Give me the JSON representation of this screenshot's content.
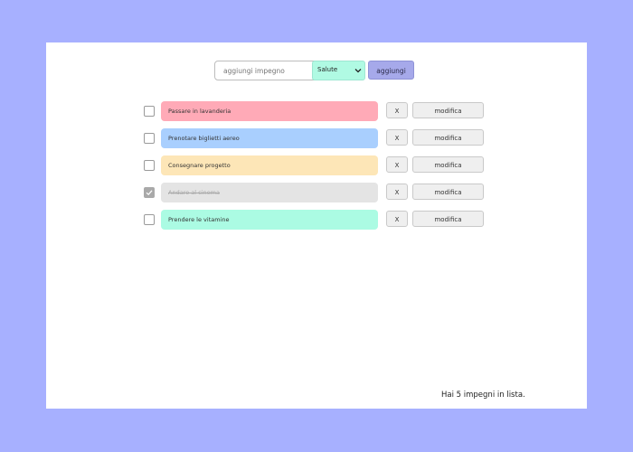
{
  "add_form": {
    "input_placeholder": "aggiungi impegno",
    "input_value": "",
    "category_selected": "Salute",
    "add_label": "aggiungi"
  },
  "todos": [
    {
      "text": "Passare in lavanderia",
      "checked": false,
      "color": "#ffaab7",
      "delete_label": "X",
      "edit_label": "modifica"
    },
    {
      "text": "Prenotare biglietti aereo",
      "checked": false,
      "color": "#a9cffe",
      "delete_label": "X",
      "edit_label": "modifica"
    },
    {
      "text": "Consegnare progetto",
      "checked": false,
      "color": "#fde6b7",
      "delete_label": "X",
      "edit_label": "modifica"
    },
    {
      "text": "Andare al cinema",
      "checked": true,
      "color": "#e4e4e4",
      "delete_label": "X",
      "edit_label": "modifica"
    },
    {
      "text": "Prendere le vitamine",
      "checked": false,
      "color": "#abfbe3",
      "delete_label": "X",
      "edit_label": "modifica"
    }
  ],
  "footer": {
    "count_text": "Hai 5 impegni in lista."
  },
  "colors": {
    "page_background": "#a7b0ff",
    "panel_background": "#ffffff",
    "add_button": "#a6a9ea",
    "category_select": "#b0fae3"
  }
}
